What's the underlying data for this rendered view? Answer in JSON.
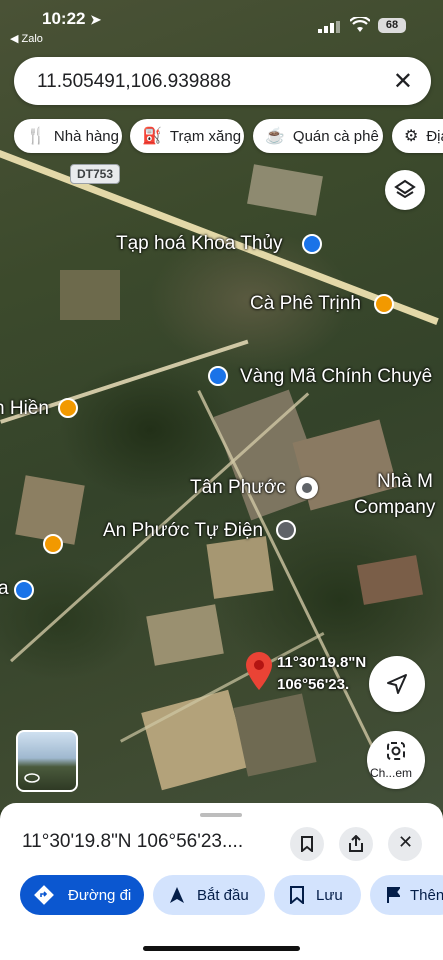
{
  "status_bar": {
    "time": "10:22",
    "back_app": "Zalo",
    "battery": "68"
  },
  "search": {
    "query": "11.505491,106.939888"
  },
  "chips": [
    {
      "label": "Nhà hàng",
      "icon": "restaurant-icon"
    },
    {
      "label": "Trạm xăng",
      "icon": "gas-station-icon"
    },
    {
      "label": "Quán cà phê",
      "icon": "coffee-icon"
    },
    {
      "label": "Địa",
      "icon": "attraction-icon"
    }
  ],
  "map": {
    "road_shield": "DT753",
    "places": {
      "tap_hoa": "Tạp hoá Khoa Thủy",
      "ca_phe_trinh": "Cà Phê Trịnh",
      "vang_ma": "Vàng Mã Chính Chuyê",
      "hien": "n Hiền",
      "tan_phuoc": "Tân Phước",
      "nha_may_1": "Nhà M",
      "nha_may_2": "Company",
      "an_phuoc": "An Phước Tự Điện",
      "a": "a"
    },
    "pin_label_line1": "11°30'19.8\"N",
    "pin_label_line2": "106°56'23."
  },
  "lens_label": "Ch...em",
  "sheet": {
    "title": "11°30'19.8\"N 106°56'23....",
    "actions": [
      {
        "label": "Đường đi",
        "icon": "directions-icon",
        "primary": true
      },
      {
        "label": "Bắt đầu",
        "icon": "navigation-arrow-icon"
      },
      {
        "label": "Lưu",
        "icon": "bookmark-icon"
      },
      {
        "label": "Thên",
        "icon": "flag-icon"
      }
    ]
  },
  "colors": {
    "accent": "#0b57d0",
    "primary_btn": "#0b57d0",
    "chip_blue": "#d3e3fd",
    "pin_red": "#ea4335",
    "poi_orange": "#f29900",
    "poi_blue": "#1a73e8"
  }
}
